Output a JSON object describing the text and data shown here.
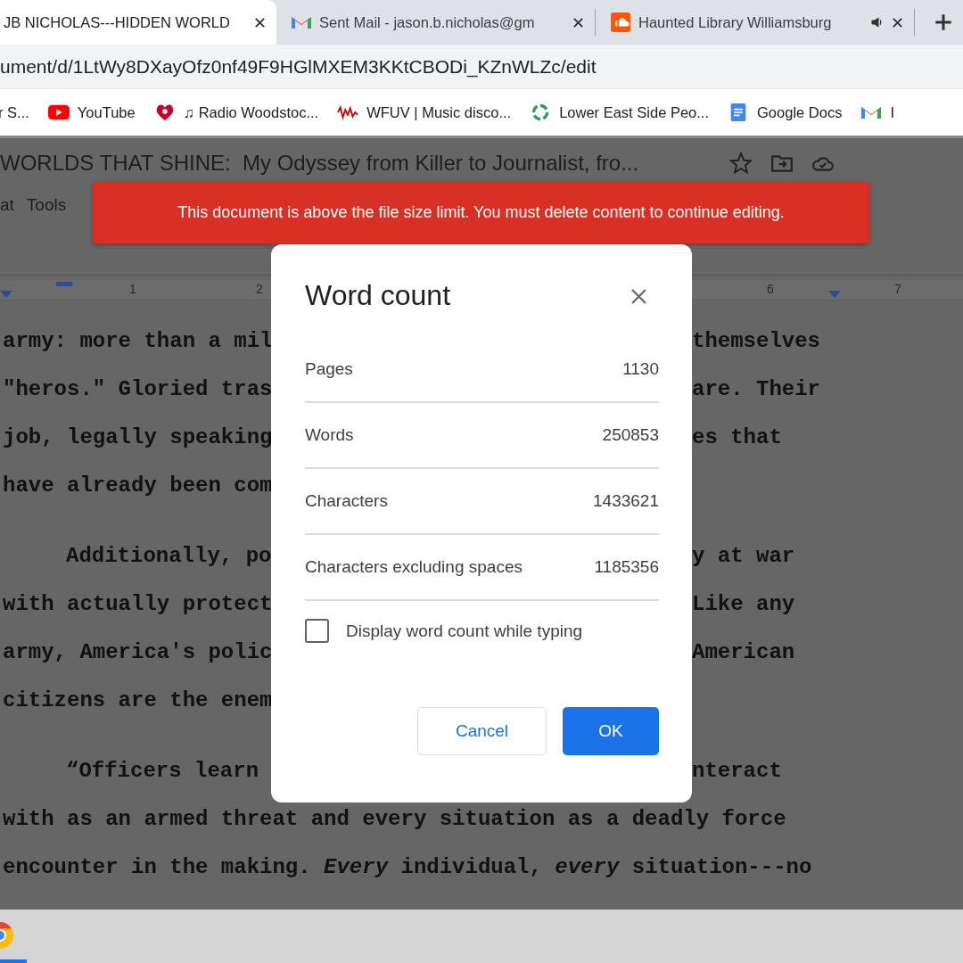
{
  "browser": {
    "tabs": [
      {
        "title": "JB NICHOLAS---HIDDEN WORLD",
        "selected": true,
        "audio": false
      },
      {
        "title": "Sent Mail - jason.b.nicholas@gm",
        "selected": false,
        "audio": false
      },
      {
        "title": "Haunted Library Williamsburg",
        "selected": false,
        "audio": true
      }
    ],
    "url": "ument/d/1LtWy8DXayOfz0nf49F9HGlMXEM3KKtCBODi_KZnWLZc/edit",
    "bookmarks": [
      {
        "label": "r S..."
      },
      {
        "label": "YouTube"
      },
      {
        "label": "♫ Radio Woodstoc..."
      },
      {
        "label": "WFUV | Music disco..."
      },
      {
        "label": "Lower East Side Peo..."
      },
      {
        "label": "Google Docs"
      },
      {
        "label": "I"
      }
    ]
  },
  "document": {
    "title": "WORLDS THAT SHINE:  My Odyssey from Killer to Journalist, fro...",
    "menu": [
      "at",
      "Tools"
    ],
    "ruler_labels": [
      "1",
      "2",
      "6",
      "7"
    ],
    "lines": [
      {
        "left": "army: more than a mil",
        "right": "themselves",
        "indent": false
      },
      {
        "left": "\"heros.\" Gloried tras",
        "right": "are. Their",
        "indent": false
      },
      {
        "left": "job, legally speaking",
        "right": "es that",
        "indent": false
      },
      {
        "left": "have already been com",
        "indent": false
      },
      {
        "left": "Additionally, po",
        "right": "y at war",
        "indent": true
      },
      {
        "left": "with actually protect",
        "right": "Like any",
        "indent": false
      },
      {
        "left": "army, America's polic",
        "right": "American",
        "indent": false
      },
      {
        "left": "citizens are the enem",
        "indent": false
      },
      {
        "left": "“Officers learn",
        "right": "nteract",
        "indent": true
      },
      {
        "left": "with as an armed threat and every situation as a deadly force",
        "indent": false
      },
      {
        "left": "encounter in the making. *Every* individual, *every* situation---no",
        "indent": false
      }
    ]
  },
  "banner": {
    "text": "This document is above the file size limit. You must delete content to continue editing."
  },
  "dialog": {
    "title": "Word count",
    "stats": [
      {
        "label": "Pages",
        "value": "1130"
      },
      {
        "label": "Words",
        "value": "250853"
      },
      {
        "label": "Characters",
        "value": "1433621"
      },
      {
        "label": "Characters excluding spaces",
        "value": "1185356"
      }
    ],
    "checkbox": {
      "label": "Display word count while typing",
      "checked": false
    },
    "buttons": [
      {
        "label": "Cancel",
        "kind": "secondary"
      },
      {
        "label": "OK",
        "kind": "primary"
      }
    ]
  }
}
